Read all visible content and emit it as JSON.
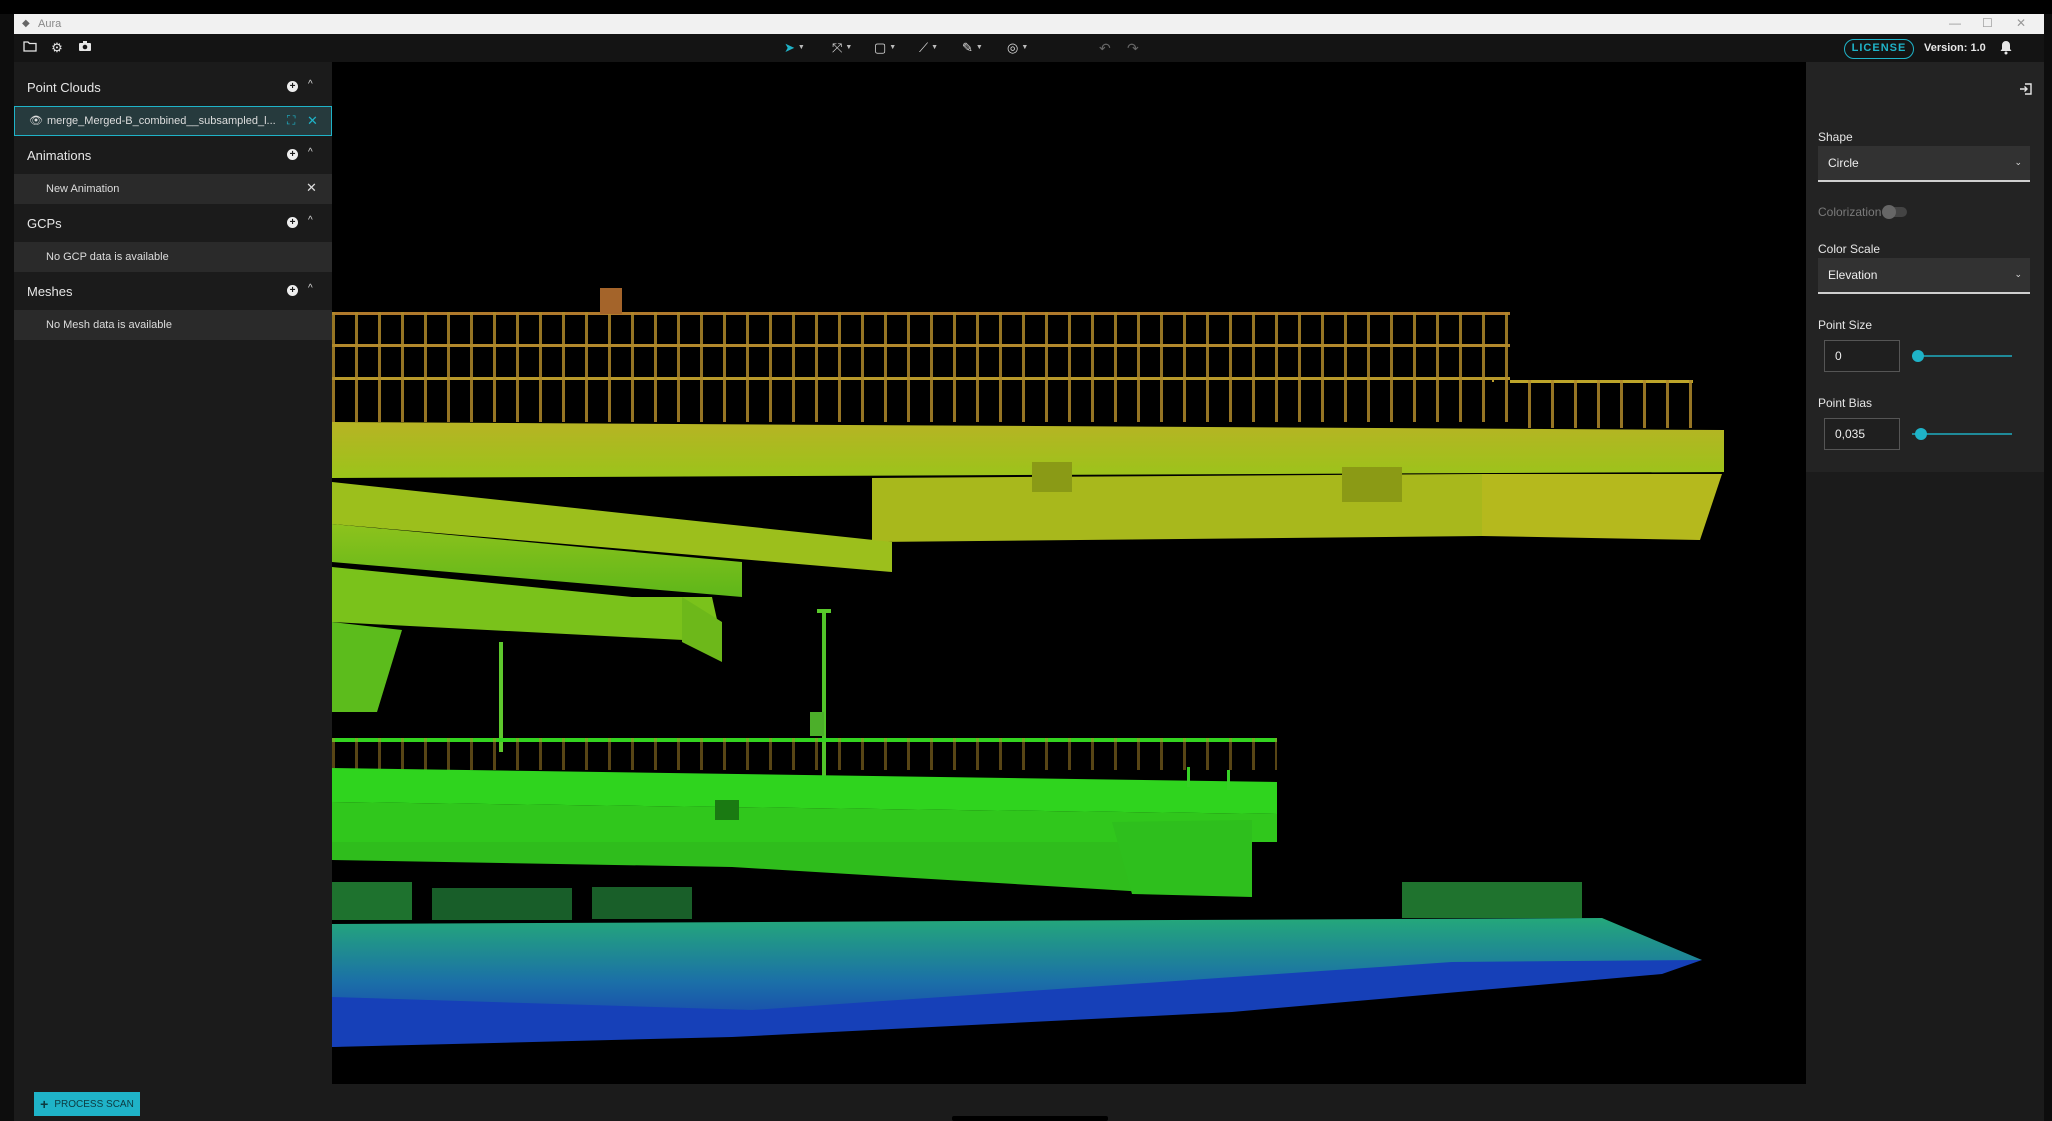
{
  "window": {
    "title": "Aura",
    "minimize": "—",
    "maximize": "☐",
    "close": "✕"
  },
  "toolbar": {
    "open_icon": "folder-icon",
    "settings_icon": "gear-icon",
    "screenshot_icon": "camera-icon",
    "tools": [
      {
        "name": "navigate-tool",
        "glyph": "➤",
        "active": true
      },
      {
        "name": "transform-tool",
        "glyph": "⤧",
        "active": false
      },
      {
        "name": "selection-tool",
        "glyph": "▢",
        "active": false
      },
      {
        "name": "measure-tool",
        "glyph": "⟋",
        "active": false
      },
      {
        "name": "brush-tool",
        "glyph": "✎",
        "active": false
      },
      {
        "name": "camera-target-tool",
        "glyph": "◎",
        "active": false
      }
    ],
    "undo_glyph": "↶",
    "redo_glyph": "↷",
    "license_label": "LICENSE",
    "version_label": "Version: 1.0",
    "bell_glyph": "🔔"
  },
  "sidebar": {
    "sections": [
      {
        "title": "Point Clouds",
        "items": [
          {
            "label": "merge_Merged-B_combined__subsampled_l...",
            "selected": true
          }
        ]
      },
      {
        "title": "Animations",
        "items": [
          {
            "label": "New Animation",
            "selected": false
          }
        ]
      },
      {
        "title": "GCPs",
        "items": [
          {
            "label": "No GCP data is available",
            "selected": false
          }
        ]
      },
      {
        "title": "Meshes",
        "items": [
          {
            "label": "No Mesh data is available",
            "selected": false
          }
        ]
      }
    ]
  },
  "panel": {
    "shape_label": "Shape",
    "shape_value": "Circle",
    "colorization_label": "Colorization",
    "colorization_on": false,
    "color_scale_label": "Color Scale",
    "color_scale_value": "Elevation",
    "point_size_label": "Point Size",
    "point_size_value": "0",
    "point_size_slider": 0,
    "point_bias_label": "Point Bias",
    "point_bias_value": "0,035",
    "point_bias_slider": 0.035
  },
  "bottom": {
    "process_label": "PROCESS SCAN"
  },
  "colors": {
    "accent": "#1fb3c8"
  }
}
